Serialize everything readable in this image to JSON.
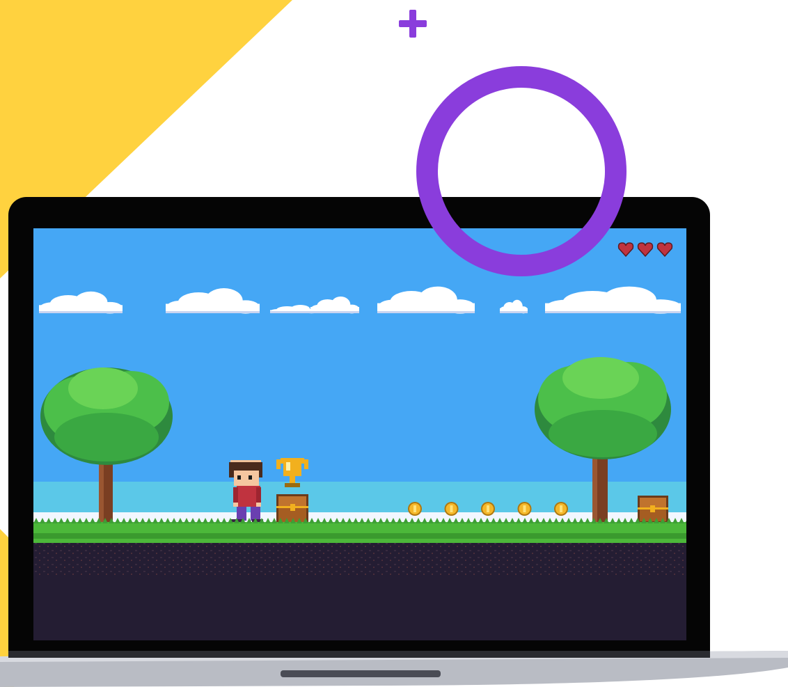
{
  "scene": {
    "background_color": "#ffffff",
    "accent_yellow": "#ffd23f",
    "accent_purple": "#8a3ddc",
    "decorations": [
      "plus-icon",
      "ring"
    ]
  },
  "game": {
    "sky_color": "#45a7f5",
    "horizon_color": "#5bc8e8",
    "grass_color": "#4cb83a",
    "dirt_color": "#241d33",
    "hud": {
      "lives_total": 3,
      "lives_remaining": 3,
      "heart_icon": "heart-icon",
      "heart_color": "#c0333f"
    },
    "player": {
      "icon": "player-character-icon"
    },
    "trophy": {
      "icon": "trophy-icon",
      "color": "#f2b01e"
    },
    "coins": {
      "count": 5,
      "icon": "coin-icon",
      "color": "#f5b82a"
    },
    "chests": {
      "count": 2,
      "icon": "treasure-chest-icon"
    },
    "trees": {
      "count": 2,
      "icon": "tree-icon"
    },
    "clouds": {
      "count": 7,
      "icon": "cloud-icon"
    }
  }
}
